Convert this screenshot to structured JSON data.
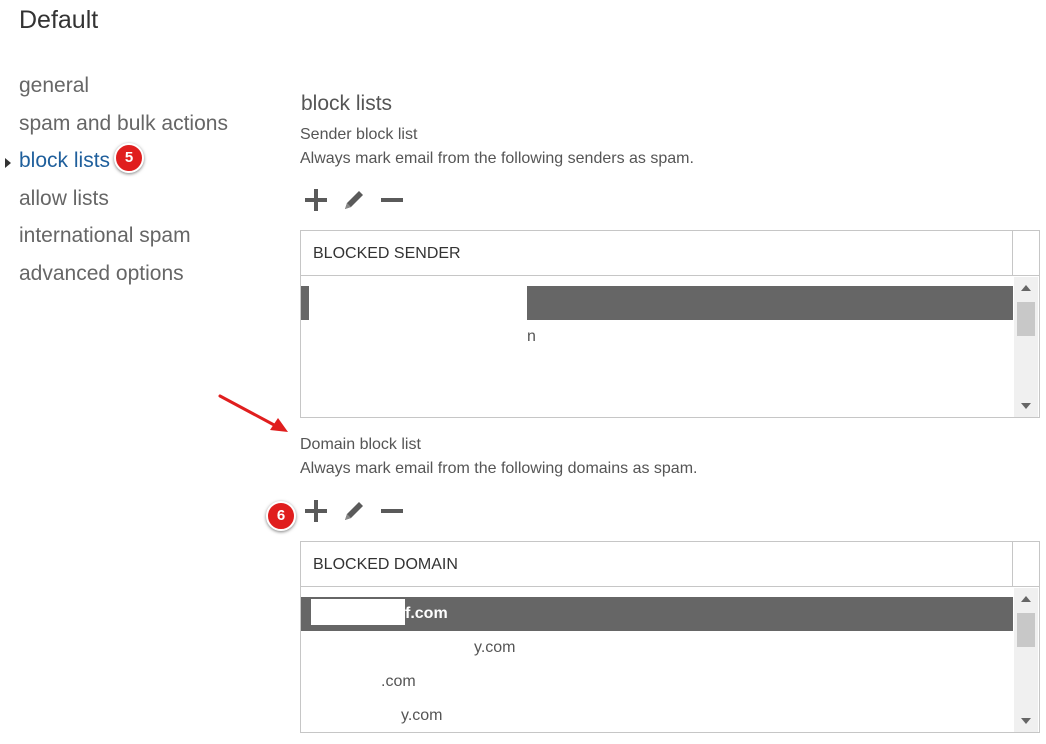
{
  "page_title": "Default",
  "nav": {
    "items": [
      {
        "label": "general"
      },
      {
        "label": "spam and bulk actions"
      },
      {
        "label": "block lists"
      },
      {
        "label": "allow lists"
      },
      {
        "label": "international spam"
      },
      {
        "label": "advanced options"
      }
    ],
    "active_badge": "5"
  },
  "section": {
    "title": "block lists",
    "sender": {
      "heading": "Sender block list",
      "description": "Always mark email from the following senders as spam.",
      "column_header": "BLOCKED SENDER",
      "rows": [
        "",
        "n",
        "",
        ""
      ]
    },
    "domain": {
      "heading": "Domain block list",
      "description": "Always mark email from the following domains as spam.",
      "column_header": "BLOCKED DOMAIN",
      "badge": "6",
      "rows": [
        "f.com",
        "y.com",
        ".com",
        "y.com"
      ]
    }
  },
  "icons": {
    "add": "plus-icon",
    "edit": "pencil-icon",
    "remove": "minus-icon"
  },
  "colors": {
    "accent": "#1f5f9c",
    "badge": "#e01e1e",
    "selected_row": "#666666"
  }
}
